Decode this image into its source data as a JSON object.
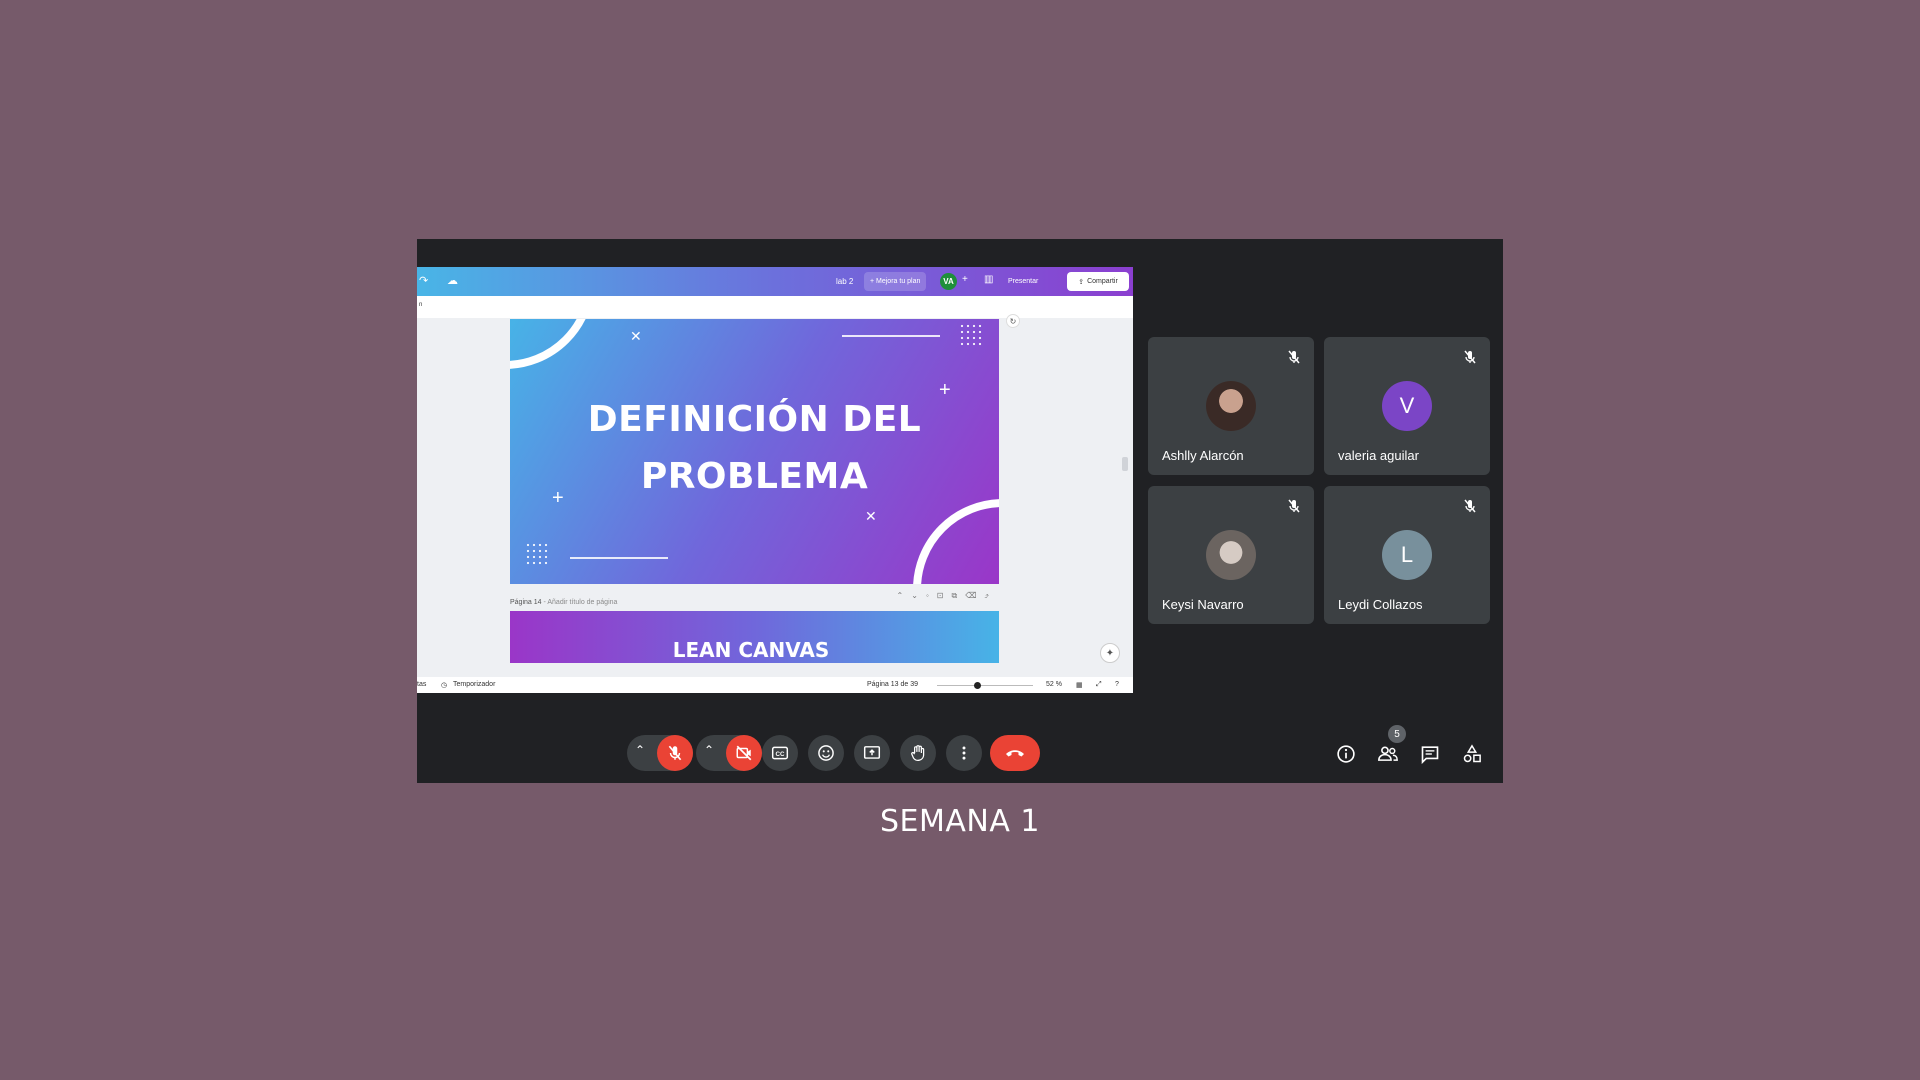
{
  "canva": {
    "doc_name": "lab 2",
    "upgrade_label": "+ Mejora tu plan",
    "user_initials": "VA",
    "present_label": "Presentar",
    "share_label": "Compartir",
    "sub_left": "n",
    "slide_title_line1": "DEFINICIÓN DEL",
    "slide_title_line2": "PROBLEMA",
    "next_page_label": "Página 14",
    "next_page_hint": " - Añadir título de página",
    "next_slide_title": "LEAN CANVAS",
    "footer_notes": "tas",
    "footer_timer": "Temporizador",
    "footer_page": "Página 13 de 39",
    "footer_zoom": "52 %"
  },
  "participants": [
    {
      "name": "Ashlly Alarcón",
      "initial": "",
      "avatar_color": "#5b4a47"
    },
    {
      "name": "valeria aguilar",
      "initial": "V",
      "avatar_color": "#7b45c6"
    },
    {
      "name": "Keysi Navarro",
      "initial": "",
      "avatar_color": "#8a8480"
    },
    {
      "name": "Leydi Collazos",
      "initial": "L",
      "avatar_color": "#78909c"
    }
  ],
  "toolbar": {
    "participants_count": "5"
  },
  "caption": "SEMANA 1",
  "colors": {
    "background": "#765a6a",
    "meet_bg": "#202124",
    "tile_bg": "#3c4043",
    "danger": "#ea4335"
  }
}
